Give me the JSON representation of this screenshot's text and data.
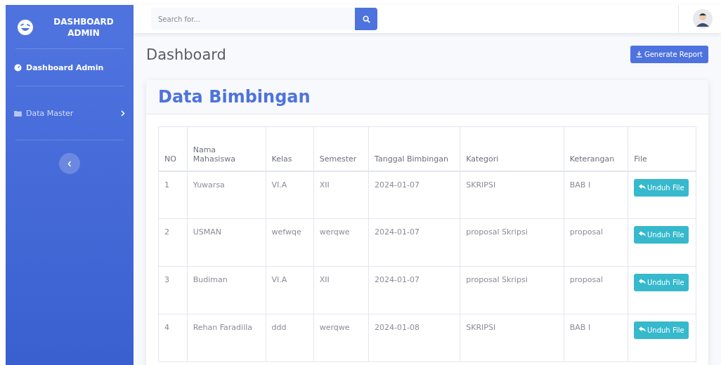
{
  "sidebar": {
    "brand": "DASHBOARD ADMIN",
    "items": [
      {
        "label": "Dashboard Admin",
        "selected": true,
        "kind": "link"
      },
      {
        "label": "Data Master",
        "selected": false,
        "kind": "menu"
      }
    ]
  },
  "topbar": {
    "search": {
      "placeholder": "Search for..."
    }
  },
  "page": {
    "title": "Dashboard",
    "action": "Generate Report"
  },
  "card": {
    "title": "Data Bimbingan",
    "table": {
      "columns": [
        "NO",
        "Nama Mahasiswa",
        "Kelas",
        "Semester",
        "Tanggal Bimbingan",
        "Kategori",
        "Keterangan",
        "File"
      ],
      "rows": [
        {
          "cells": [
            "1",
            "Yuwarsa",
            "VI.A",
            "XII",
            "2024-01-07",
            "SKRIPSI",
            "BAB I"
          ],
          "action": "Unduh File"
        },
        {
          "cells": [
            "2",
            "USMAN",
            "wefwqe",
            "werqwe",
            "2024-01-07",
            "proposal Skripsi",
            "proposal"
          ],
          "action": "Unduh File"
        },
        {
          "cells": [
            "3",
            "Budiman",
            "VI.A",
            "XII",
            "2024-01-07",
            "proposal Skripsi",
            "proposal"
          ],
          "action": "Unduh File"
        },
        {
          "cells": [
            "4",
            "Rehan Faradilla",
            "ddd",
            "werqwe",
            "2024-01-08",
            "SKRIPSI",
            "BAB I"
          ],
          "action": "Unduh File"
        }
      ]
    }
  }
}
